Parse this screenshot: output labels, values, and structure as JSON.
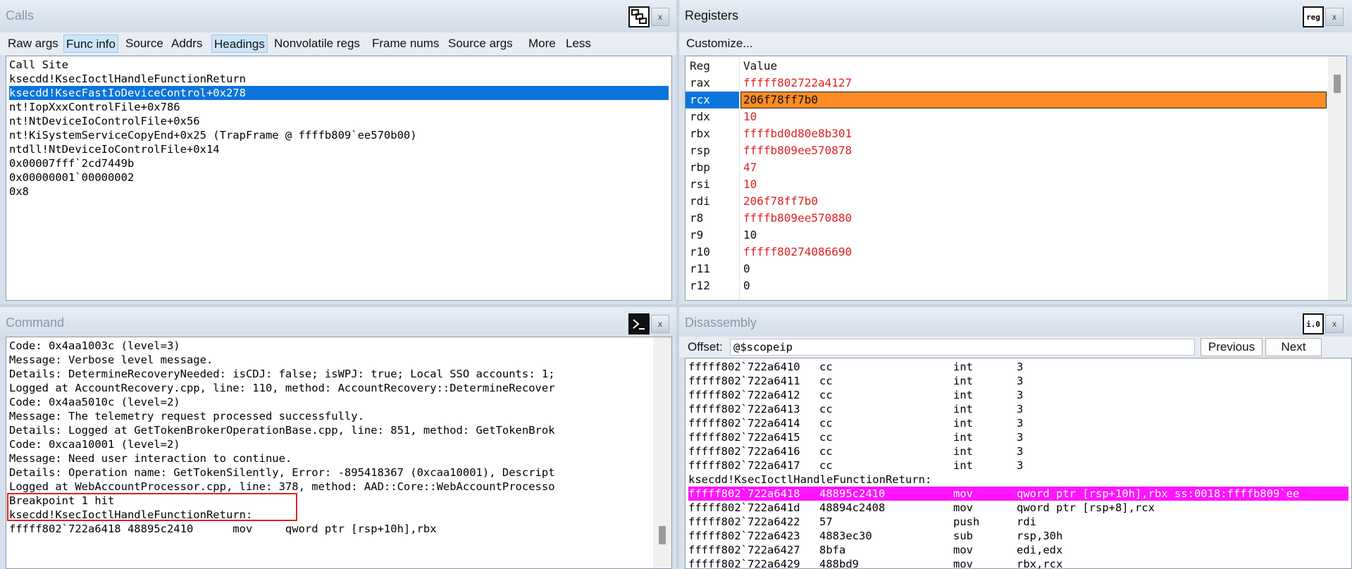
{
  "calls": {
    "title": "Calls",
    "close": "x",
    "toolbar": [
      {
        "label": "Raw args",
        "on": false
      },
      {
        "label": "Func info",
        "on": true
      },
      {
        "label": "Source",
        "on": false
      },
      {
        "label": "Addrs",
        "on": false
      },
      {
        "label": "Headings",
        "on": true
      },
      {
        "label": "Nonvolatile regs",
        "on": false
      },
      {
        "label": "Frame nums",
        "on": false
      },
      {
        "label": "Source args",
        "on": false
      },
      {
        "label": "More",
        "on": false
      },
      {
        "label": "Less",
        "on": false
      }
    ],
    "header": "Call Site",
    "frames": [
      "ksecdd!KsecIoctlHandleFunctionReturn",
      "ksecdd!KsecFastIoDeviceControl+0x278",
      "nt!IopXxxControlFile+0x786",
      "nt!NtDeviceIoControlFile+0x56",
      "nt!KiSystemServiceCopyEnd+0x25 (TrapFrame @ ffffb809`ee570b00)",
      "ntdll!NtDeviceIoControlFile+0x14",
      "0x00007fff`2cd7449b",
      "0x00000001`00000002",
      "0x8"
    ],
    "selected_index": 1
  },
  "registers": {
    "title": "Registers",
    "icon_label": "reg",
    "close": "x",
    "customize": "Customize...",
    "col_reg": "Reg",
    "col_value": "Value",
    "rows": [
      {
        "name": "rax",
        "value": "fffff802722a4127",
        "changed": true
      },
      {
        "name": "rcx",
        "value": "206f78ff7b0",
        "changed": true
      },
      {
        "name": "rdx",
        "value": "10",
        "changed": true
      },
      {
        "name": "rbx",
        "value": "ffffbd0d80e8b301",
        "changed": true
      },
      {
        "name": "rsp",
        "value": "ffffb809ee570878",
        "changed": true
      },
      {
        "name": "rbp",
        "value": "47",
        "changed": true
      },
      {
        "name": "rsi",
        "value": "10",
        "changed": true
      },
      {
        "name": "rdi",
        "value": "206f78ff7b0",
        "changed": true
      },
      {
        "name": "r8",
        "value": "ffffb809ee570880",
        "changed": true
      },
      {
        "name": "r9",
        "value": "10",
        "changed": false
      },
      {
        "name": "r10",
        "value": "fffff80274086690",
        "changed": true
      },
      {
        "name": "r11",
        "value": "0",
        "changed": false
      },
      {
        "name": "r12",
        "value": "0",
        "changed": false
      }
    ],
    "selected_index": 1
  },
  "command": {
    "title": "Command",
    "close": "x",
    "lines": [
      "Code: 0x4aa1003c (level=3)",
      "Message: Verbose level message.",
      "Details: DetermineRecoveryNeeded: isCDJ: false; isWPJ: true; Local SSO accounts: 1;",
      "Logged at AccountRecovery.cpp, line: 110, method: AccountRecovery::DetermineRecover",
      "Code: 0x4aa5010c (level=2)",
      "Message: The telemetry request processed successfully.",
      "Details: Logged at GetTokenBrokerOperationBase.cpp, line: 851, method: GetTokenBrok",
      "Code: 0xcaa10001 (level=2)",
      "Message: Need user interaction to continue.",
      "Details: Operation name: GetTokenSilently, Error: -895418367 (0xcaa10001), Descript",
      "Logged at WebAccountProcessor.cpp, line: 378, method: AAD::Core::WebAccountProcesso",
      "Breakpoint 1 hit",
      "ksecdd!KsecIoctlHandleFunctionReturn:",
      "fffff802`722a6418 48895c2410      mov     qword ptr [rsp+10h],rbx"
    ]
  },
  "disassembly": {
    "title": "Disassembly",
    "icon_label": "i.0",
    "close": "x",
    "offset_label": "Offset:",
    "offset_value": "@$scopeip",
    "previous": "Previous",
    "next": "Next",
    "rows": [
      {
        "addr": "fffff802`722a6410",
        "bytes": "cc",
        "op": "int",
        "args": "3"
      },
      {
        "addr": "fffff802`722a6411",
        "bytes": "cc",
        "op": "int",
        "args": "3"
      },
      {
        "addr": "fffff802`722a6412",
        "bytes": "cc",
        "op": "int",
        "args": "3"
      },
      {
        "addr": "fffff802`722a6413",
        "bytes": "cc",
        "op": "int",
        "args": "3"
      },
      {
        "addr": "fffff802`722a6414",
        "bytes": "cc",
        "op": "int",
        "args": "3"
      },
      {
        "addr": "fffff802`722a6415",
        "bytes": "cc",
        "op": "int",
        "args": "3"
      },
      {
        "addr": "fffff802`722a6416",
        "bytes": "cc",
        "op": "int",
        "args": "3"
      },
      {
        "addr": "fffff802`722a6417",
        "bytes": "cc",
        "op": "int",
        "args": "3"
      },
      {
        "label": "ksecdd!KsecIoctlHandleFunctionReturn:"
      },
      {
        "addr": "fffff802`722a6418",
        "bytes": "48895c2410",
        "op": "mov",
        "args": "qword ptr [rsp+10h],rbx ss:0018:ffffb809`ee",
        "current": true
      },
      {
        "addr": "fffff802`722a641d",
        "bytes": "48894c2408",
        "op": "mov",
        "args": "qword ptr [rsp+8],rcx"
      },
      {
        "addr": "fffff802`722a6422",
        "bytes": "57",
        "op": "push",
        "args": "rdi"
      },
      {
        "addr": "fffff802`722a6423",
        "bytes": "4883ec30",
        "op": "sub",
        "args": "rsp,30h"
      },
      {
        "addr": "fffff802`722a6427",
        "bytes": "8bfa",
        "op": "mov",
        "args": "edi,edx"
      },
      {
        "addr": "fffff802`722a6429",
        "bytes": "488bd9",
        "op": "mov",
        "args": "rbx,rcx"
      }
    ]
  },
  "colors": {
    "selection": "#0a74da",
    "changed_value": "#e02020",
    "register_highlight": "#fb8b24",
    "current_instruction": "#ff14ff",
    "callout": "#e02020"
  }
}
